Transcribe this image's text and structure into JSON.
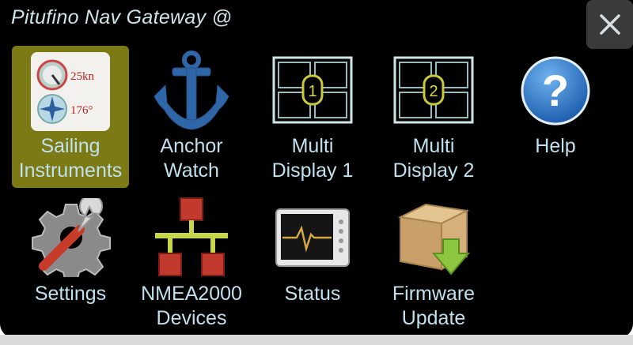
{
  "window": {
    "title": "Pitufino Nav Gateway @"
  },
  "close_button": {
    "icon": "close-icon"
  },
  "menu": [
    {
      "id": "sailing-instruments",
      "label_line1": "Sailing",
      "label_line2": "Instruments",
      "selected": true,
      "icon": "sailing-instruments-icon",
      "speed_text": "25kn",
      "heading_text": "176°"
    },
    {
      "id": "anchor-watch",
      "label_line1": "Anchor",
      "label_line2": "Watch",
      "icon": "anchor-icon"
    },
    {
      "id": "multi-display-1",
      "label_line1": "Multi",
      "label_line2": "Display 1",
      "icon": "multi-display-icon",
      "badge": "1"
    },
    {
      "id": "multi-display-2",
      "label_line1": "Multi",
      "label_line2": "Display 2",
      "icon": "multi-display-icon",
      "badge": "2"
    },
    {
      "id": "help",
      "label_line1": "Help",
      "icon": "help-icon",
      "glyph": "?"
    },
    {
      "id": "settings",
      "label_line1": "Settings",
      "icon": "settings-icon"
    },
    {
      "id": "nmea2000-devices",
      "label_line1": "NMEA2000",
      "label_line2": "Devices",
      "icon": "network-icon"
    },
    {
      "id": "status",
      "label_line1": "Status",
      "icon": "status-monitor-icon"
    },
    {
      "id": "firmware-update",
      "label_line1": "Firmware",
      "label_line2": "Update",
      "icon": "firmware-box-icon"
    }
  ],
  "colors": {
    "background": "#000000",
    "label": "#bfe0ec",
    "selected": "#7c7a14"
  }
}
